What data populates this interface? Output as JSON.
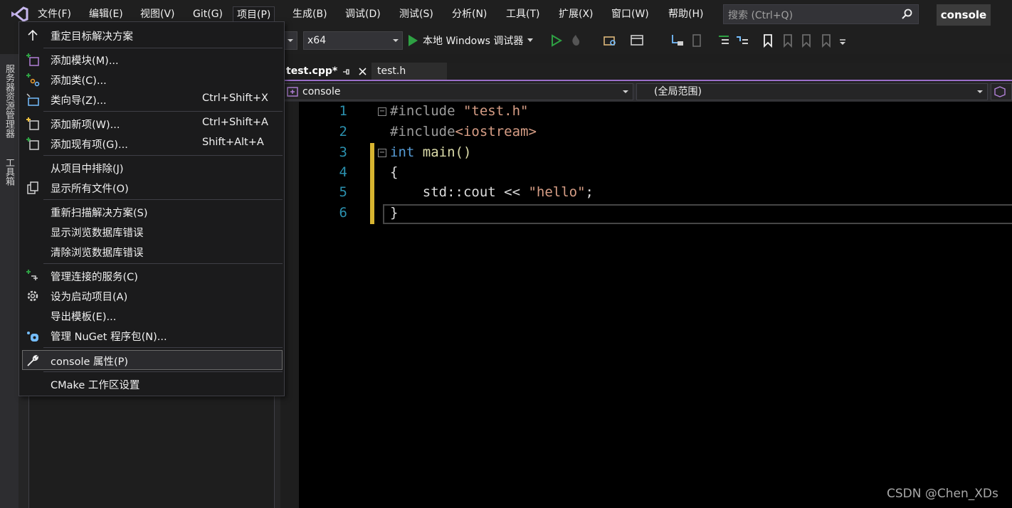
{
  "menubar": {
    "items": [
      "文件(F)",
      "编辑(E)",
      "视图(V)",
      "Git(G)",
      "项目(P)",
      "生成(B)",
      "调试(D)",
      "测试(S)",
      "分析(N)",
      "工具(T)",
      "扩展(X)",
      "窗口(W)",
      "帮助(H)"
    ],
    "search_placeholder": "搜索 (Ctrl+Q)",
    "solution_name": "console"
  },
  "toolbar": {
    "platform": "x64",
    "run_label": "本地 Windows 调试器"
  },
  "side_tabs": [
    "服务器资源管理器",
    "工具箱"
  ],
  "editor": {
    "tabs": [
      "test.cpp*",
      "test.h"
    ],
    "nav_project": "console",
    "nav_scope": "(全局范围)",
    "line_numbers": [
      "1",
      "2",
      "3",
      "4",
      "5",
      "6"
    ],
    "code": {
      "l1_pp": "#include ",
      "l1_str": "\"test.h\"",
      "l2_pp": "#include",
      "l2_str": "<iostream>",
      "l3_kw": "int",
      "l3_rest": " main()",
      "l4": "{",
      "l5_a": "    std::cout << ",
      "l5_str": "\"hello\"",
      "l5_b": ";",
      "l6": "}"
    }
  },
  "project_menu": {
    "items": [
      {
        "label": "重定目标解决方案",
        "shortcut": "",
        "icon": "arrow-up-icon"
      },
      {
        "label": "添加模块(M)...",
        "shortcut": "",
        "icon": "add-module-icon"
      },
      {
        "label": "添加类(C)...",
        "shortcut": "",
        "icon": "add-class-icon"
      },
      {
        "label": "类向导(Z)...",
        "shortcut": "Ctrl+Shift+X",
        "icon": "class-wizard-icon"
      },
      {
        "label": "添加新项(W)...",
        "shortcut": "Ctrl+Shift+A",
        "icon": "add-new-item-icon"
      },
      {
        "label": "添加现有项(G)...",
        "shortcut": "Shift+Alt+A",
        "icon": "add-existing-item-icon"
      },
      {
        "label": "从项目中排除(J)",
        "shortcut": "",
        "icon": ""
      },
      {
        "label": "显示所有文件(O)",
        "shortcut": "",
        "icon": "show-all-files-icon"
      },
      {
        "label": "重新扫描解决方案(S)",
        "shortcut": "",
        "icon": ""
      },
      {
        "label": "显示浏览数据库错误",
        "shortcut": "",
        "icon": ""
      },
      {
        "label": "清除浏览数据库错误",
        "shortcut": "",
        "icon": ""
      },
      {
        "label": "管理连接的服务(C)",
        "shortcut": "",
        "icon": "connected-services-icon"
      },
      {
        "label": "设为启动项目(A)",
        "shortcut": "",
        "icon": "gear-icon"
      },
      {
        "label": "导出模板(E)...",
        "shortcut": "",
        "icon": ""
      },
      {
        "label": "管理 NuGet 程序包(N)...",
        "shortcut": "",
        "icon": "nuget-icon"
      },
      {
        "label": "console 属性(P)",
        "shortcut": "",
        "icon": "wrench-icon"
      },
      {
        "label": "CMake 工作区设置",
        "shortcut": "",
        "icon": ""
      }
    ]
  },
  "watermark": "CSDN @Chen_XDs",
  "colors": {
    "accent_purple": "#9a6ec9",
    "change_bar": "#d7b430",
    "keyword": "#569cd6",
    "string": "#d69d85",
    "line_number": "#2b91af"
  }
}
